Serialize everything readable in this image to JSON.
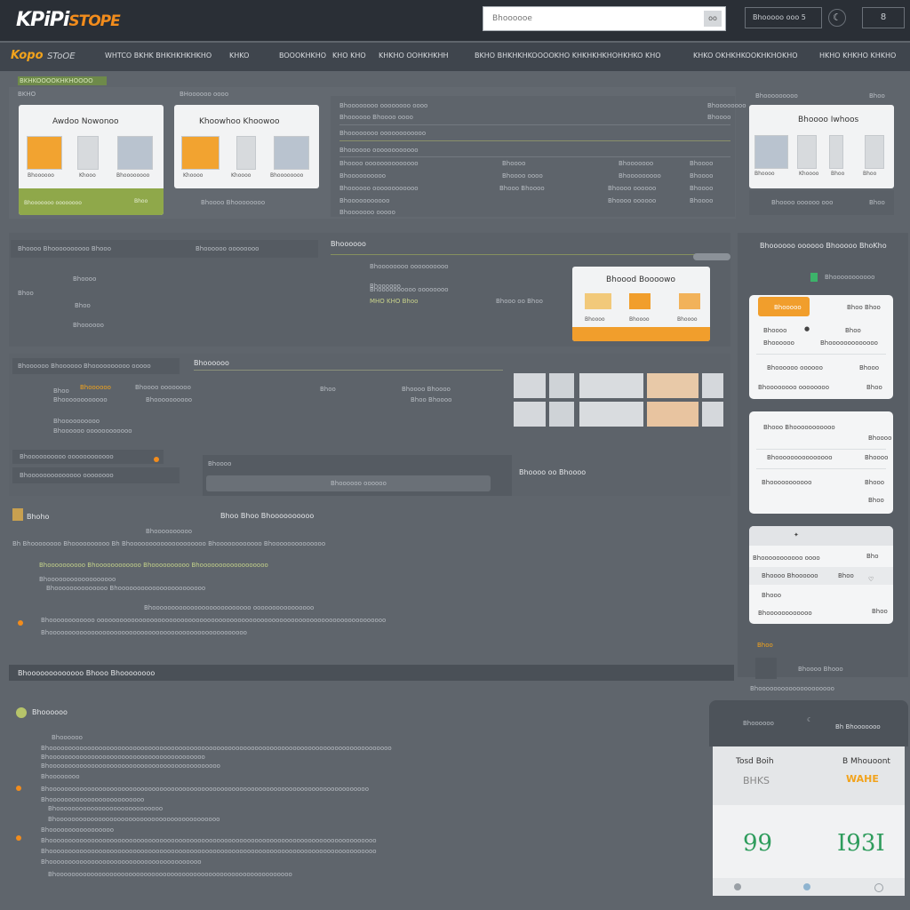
{
  "header": {
    "logo_main": "KPiPi",
    "logo_sub": "STOPE",
    "search_placeholder": "Bhoooooe",
    "search_button": "oo",
    "account_label": "Bhooooo ooo 5",
    "theme_icon": "moon-icon",
    "cart_label": "8"
  },
  "nav": {
    "brand": "Kopo",
    "brand_sub": "SToOE",
    "items": [
      "WHTCO BKHK BHKHKHKHKHO",
      "KHKO",
      "BOOOKHKHO",
      "KHO KHO",
      "KHKHO OOHKHKHH",
      "BKHO BHKHKHKOOOOKHO KHKHKHKHOHKHKO KHO",
      "KHKO OKHKHKOOKHKHOKHO",
      "HKHO KHKHO KHKHO"
    ]
  },
  "top_row": {
    "label_green": "BKHKOOOOKHKHOOOO",
    "card1": {
      "header": "BKHO",
      "title": "Awdoo Nowonoo",
      "caps": [
        "Bhoooooo",
        "Khooo",
        "Bhoooooooo"
      ],
      "footer_left": "Bhooooooo oooooooo",
      "footer_right": "Bhoo"
    },
    "card2": {
      "header": "BHoooooo oooo",
      "title": "Khoowhoo Khoowoo",
      "caps": [
        "Khoooo",
        "Khoooo",
        "Bhoooooooo"
      ],
      "footer_left": "Bhoooo Bhoooooooo",
      "footer_right": ""
    },
    "middle": {
      "rows": [
        [
          "Bhoooooooo oooooooo oooo",
          "Bhoooooooo"
        ],
        [
          "Bhoooooo Bhoooo oooo",
          "Bhoooo"
        ],
        [
          "Bhoooooooo oooooooooooo",
          ""
        ],
        [
          "Bhoooooo oooooooooooo",
          ""
        ],
        [
          "Bhoooo oooooooooooooo",
          "Bhoooo",
          "Bhooooooo",
          "Bhoooo"
        ],
        [
          "Bhoooooooooo",
          "Bhoooo oooo",
          "Bhooooooooo",
          "Bhoooo"
        ],
        [
          "Bhoooooo oooooooooooo",
          "Bhooo Bhoooo",
          "Bhoooo oooooo",
          "Bhoooo"
        ],
        [
          "Bhooooooooooo",
          "",
          "Bhoooo oooooo",
          "Bhoooo"
        ],
        [
          "Bhooooooo ooooo",
          "",
          "",
          ""
        ]
      ]
    },
    "card3": {
      "header": "Bhooooooooo",
      "header_right": "Bhoo",
      "title": "Bhoooo Iwhoos",
      "caps": [
        "Bhoooo",
        "Khoooo",
        "Bhoo",
        "Bhoo"
      ],
      "footer_left": "Bhoooo oooooo ooo",
      "footer_right": "Bhoo"
    }
  },
  "mid_section": {
    "left_header": [
      "Bhoooo Bhoooooooooo Bhooo",
      "Bhoooooo oooooooo"
    ],
    "left_rows": [
      "Bhoooo",
      "Bhoo",
      "Bhoo",
      "Bhoooooo"
    ],
    "center_title": "Bhoooooo",
    "center_rows": [
      "Bhoooooooo oooooooooo",
      "Bhoooooo",
      "Bhoooooooooo oooooooo",
      "MHO KHO Bhoo"
    ],
    "center_right": "Bhooo oo Bhoo",
    "popup": {
      "title": "Bhoood Boooowo",
      "caps": [
        "Bhoooo",
        "Bhoooo",
        "Bhoooo"
      ]
    }
  },
  "right_column": {
    "title": "Bhoooooo oooooo Bhooooo BhoKho",
    "status": "Bhooooooooooo",
    "w1": {
      "tag": "Bhooooo",
      "tag_right": "Bhoo Bhoo",
      "rows": [
        [
          "Bhoooo",
          "Bhoo"
        ],
        [
          "Bhoooooo",
          "Bhooooooooooooo"
        ],
        [
          "Bhoooooo oooooo",
          "Bhooo"
        ],
        [
          "Bhoooooooo oooooooo",
          "Bhoo"
        ]
      ]
    },
    "w2": {
      "rows": [
        [
          "Bhooo Bhooooooooooo",
          "Bhoooo"
        ],
        [
          "Bhooooooooooooooo",
          "Bhoooo"
        ],
        [
          "Bhooooooooooo",
          "Bhooo"
        ],
        [
          "",
          "Bhoo"
        ]
      ]
    },
    "w3": {
      "rows": [
        [
          "Bhooooooooooo oooo",
          "Bho"
        ],
        [
          "Bhoooo Bhoooooo",
          "Bhoo"
        ],
        [
          "Bhooo",
          ""
        ],
        [
          "Bhoooooooooooo",
          "Bhoo"
        ]
      ]
    },
    "below": [
      "Bhoo",
      "Bhoooo Bhooo",
      "Bhoooooooooooooooooooo"
    ]
  },
  "section2": {
    "filters": [
      "Bhoooooo Bhoooooo",
      "Bhoooooooooo ooooo"
    ],
    "title": "Bhoooooo",
    "rows": [
      [
        "Bhoo",
        "Bhoooooo",
        "Bhoooo oooooooo",
        "Bhoo",
        "Bhoooo Bhoooo"
      ],
      [
        "Bhoooooooooooo",
        "Bhoooooooooo",
        "",
        "",
        "Bhoo Bhoooo"
      ],
      [
        "Bhoooooooooo",
        "",
        "",
        "",
        ""
      ],
      [
        "Bhoooooo oooooooooooo",
        "",
        "",
        "",
        ""
      ]
    ],
    "input_left1": "Bhoooooooooo oooooooooooo",
    "input_left2": "Bhoooooooooooooo oooooooo",
    "input_mid": "Bhoooo",
    "button_mid": "Bhoooooo oooooo",
    "label": "Bhoooo oo Bhoooo"
  },
  "section3": {
    "title": "Bhoho",
    "subtitle": "Bhoo Bhoo Bhoooooooooo",
    "lines": [
      "Bhoooooooooo",
      "Bh Bhoooooooo Bhoooooooooo  Bh Bhoooooooooooooooooooo Bhoooooooooooo Bhoooooooooooooo",
      "Bhoooooooooo   Bhoooooooooooo   Bhoooooooooo   Bhoooooooooooooooooo",
      "Bhoooooooooooooooooo",
      "Bhoooooooooooooo   Bhooooooooooooooooooooooo",
      "Bhoooooooooooooooooooooooooo oooooooooooooooo",
      "Bhoooooooooooo oooooooooooooooooooooooooooooooooooooooooooooooooooooooooooooooooooooooooooo",
      "Bhoooooooooooooooooooooooooooooooooooooooooooooooooooo"
    ]
  },
  "banner": "Bhooooooooooooo Bhooo Bhoooooooo",
  "section4": {
    "title": "Bhoooooo",
    "lines": [
      "Bhoooooo",
      "Bhoooooooooooooooooooooooooooooooooooooooooooooooooooooooooooooooooooooooooooooooooooooooooo",
      "Bhooooooooooooooooooooooooooooooooooooooooo",
      "Bhooooooooooooooooooooooooooooooooooooooooooooo",
      "Bhoooooooo",
      "Bhoooooooooooooooooooooooooooooooooooooooooooooooooooooooooooooooooooooooooooooooooooo",
      "Bhooooooooooooooooooooooooo",
      "Bhoooooooooooooooooooooooooooo",
      "Bhooooooooooooooooooooooooooooooooooooooooooo",
      "Bhooooooooooooooooo",
      "Bhoooooooooooooooooooooooooooooooooooooooooooooooooooooooooooooooooooooooooooooooooooooo",
      "Bhoooooooooooooooooooooooooooooooooooooooooooooooooooooooooooooooooooooooooooooooooooooo",
      "Bhoooooooooooooooooooooooooooooooooooooooo",
      "Bhoooooooooooooooooooooooooooooooooooooooooooooooooooooooooooooo"
    ]
  },
  "stats_card": {
    "top_left": "Bhoooooo",
    "top_right": "Bh Bhooooooo",
    "col1_label": "Tosd Boih",
    "col1_sub": "BHKS",
    "col1_value": "99",
    "col2_label": "B Mhouoont",
    "col2_sub": "WAHE",
    "col2_value": "I93I"
  },
  "colors": {
    "accent": "#f28c1c",
    "green": "#8fa84a",
    "bg": "#5f656c",
    "topbar": "#2a2f36"
  }
}
